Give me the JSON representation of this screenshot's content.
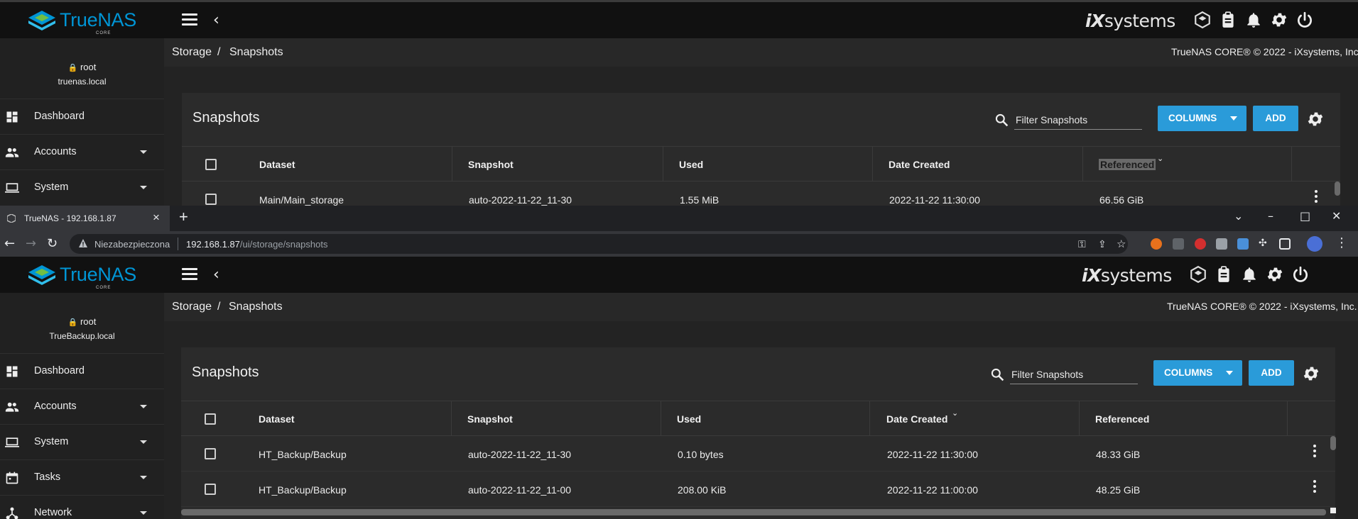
{
  "app": {
    "logo_text": "TrueNAS",
    "logo_sub": "CORE",
    "vendor_logo": "iXsystems",
    "copyright": "TrueNAS CORE® © 2022 - iXsystems, Inc."
  },
  "top_window": {
    "user": "root",
    "host": "truenas.local",
    "breadcrumb": {
      "root": "Storage",
      "sep": "/",
      "current": "Snapshots"
    },
    "sidebar": [
      {
        "label": "Dashboard",
        "icon": "dashboard-icon",
        "expandable": false
      },
      {
        "label": "Accounts",
        "icon": "people-icon",
        "expandable": true
      },
      {
        "label": "System",
        "icon": "laptop-icon",
        "expandable": true
      }
    ],
    "card": {
      "title": "Snapshots",
      "filter_placeholder": "Filter Snapshots",
      "columns_button": "COLUMNS",
      "add_button": "ADD",
      "headers": [
        "Dataset",
        "Snapshot",
        "Used",
        "Date Created",
        "Referenced"
      ],
      "sorted_column": "Referenced",
      "rows": [
        {
          "dataset": "Main/Main_storage",
          "snapshot": "auto-2022-11-22_11-30",
          "used": "1.55 MiB",
          "date": "2022-11-22 11:30:00",
          "referenced": "66.56 GiB"
        }
      ]
    }
  },
  "browser": {
    "tab_title": "TrueNAS - 192.168.1.87",
    "insecure_label": "Niezabezpieczona",
    "url_host": "192.168.1.87",
    "url_path": "/ui/storage/snapshots"
  },
  "bottom_window": {
    "user": "root",
    "host": "TrueBackup.local",
    "breadcrumb": {
      "root": "Storage",
      "sep": "/",
      "current": "Snapshots"
    },
    "sidebar": [
      {
        "label": "Dashboard",
        "icon": "dashboard-icon",
        "expandable": false
      },
      {
        "label": "Accounts",
        "icon": "people-icon",
        "expandable": true
      },
      {
        "label": "System",
        "icon": "laptop-icon",
        "expandable": true
      },
      {
        "label": "Tasks",
        "icon": "calendar-icon",
        "expandable": true
      },
      {
        "label": "Network",
        "icon": "network-icon",
        "expandable": true
      }
    ],
    "card": {
      "title": "Snapshots",
      "filter_placeholder": "Filter Snapshots",
      "columns_button": "COLUMNS",
      "add_button": "ADD",
      "headers": [
        "Dataset",
        "Snapshot",
        "Used",
        "Date Created",
        "Referenced"
      ],
      "sorted_column": "Date Created",
      "rows": [
        {
          "dataset": "HT_Backup/Backup",
          "snapshot": "auto-2022-11-22_11-30",
          "used": "0.10 bytes",
          "date": "2022-11-22 11:30:00",
          "referenced": "48.33 GiB"
        },
        {
          "dataset": "HT_Backup/Backup",
          "snapshot": "auto-2022-11-22_11-00",
          "used": "208.00 KiB",
          "date": "2022-11-22 11:00:00",
          "referenced": "48.25 GiB"
        }
      ]
    }
  },
  "colors": {
    "accent": "#2a9bd9",
    "brand": "#0095d5",
    "background": "#232323",
    "card": "#2b2b2b",
    "topbar": "#111111"
  }
}
